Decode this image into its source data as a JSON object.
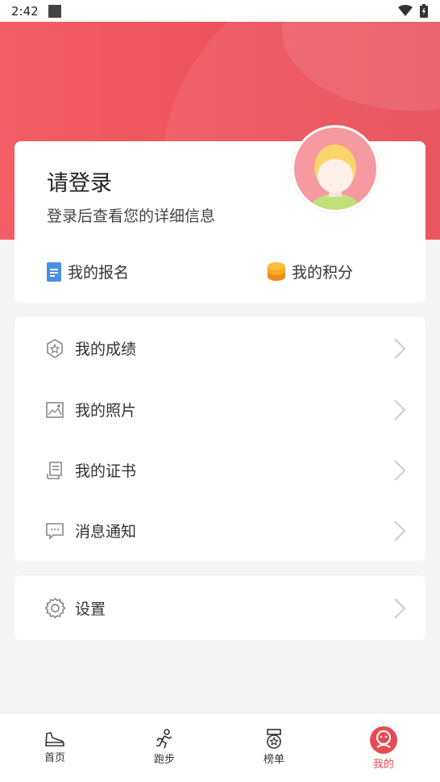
{
  "status_bar": {
    "time": "2:42"
  },
  "profile": {
    "title": "请登录",
    "subtitle": "登录后查看您的详细信息",
    "quick_links": [
      {
        "label": "我的报名",
        "icon": "document-icon",
        "color": "#4a90e2"
      },
      {
        "label": "我的积分",
        "icon": "coin-stack-icon",
        "color": "#f5a623"
      }
    ]
  },
  "menu": {
    "items": [
      {
        "label": "我的成绩",
        "icon": "star-badge-icon"
      },
      {
        "label": "我的照片",
        "icon": "photo-icon"
      },
      {
        "label": "我的证书",
        "icon": "certificate-icon"
      },
      {
        "label": "消息通知",
        "icon": "message-icon"
      }
    ]
  },
  "settings": {
    "label": "设置",
    "icon": "gear-icon"
  },
  "bottom_nav": {
    "items": [
      {
        "label": "首页",
        "icon": "shoe-icon",
        "active": false
      },
      {
        "label": "跑步",
        "icon": "runner-icon",
        "active": false
      },
      {
        "label": "榜单",
        "icon": "medal-icon",
        "active": false
      },
      {
        "label": "我的",
        "icon": "profile-face-icon",
        "active": true
      }
    ]
  },
  "colors": {
    "accent": "#e84a52",
    "header_gradient_start": "#f35e66",
    "header_gradient_end": "#e74a53"
  }
}
